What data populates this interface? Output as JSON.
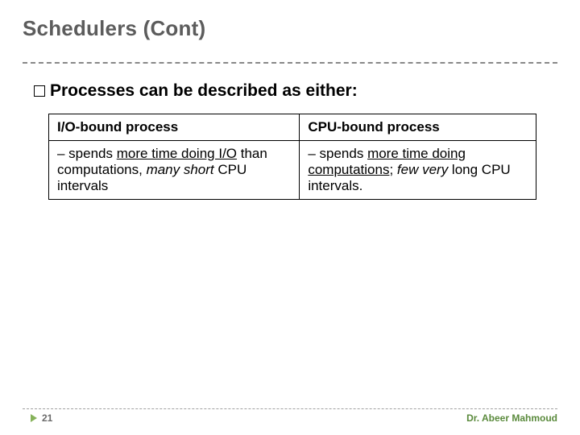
{
  "title": "Schedulers (Cont)",
  "bullet": "Processes can be described as either:",
  "table": {
    "headers": [
      "I/O-bound process",
      "CPU-bound process"
    ],
    "rows": [
      {
        "left": {
          "prefix": "– spends ",
          "u1": "more time doing I/O",
          "mid": " than computations, ",
          "i1": "many short",
          "suffix": " CPU intervals"
        },
        "right": {
          "prefix": "– spends ",
          "u1": "more time doing computations",
          "mid": "; ",
          "i1": "few very",
          "suffix": " long CPU intervals."
        }
      }
    ]
  },
  "page": "21",
  "author": "Dr. Abeer Mahmoud"
}
